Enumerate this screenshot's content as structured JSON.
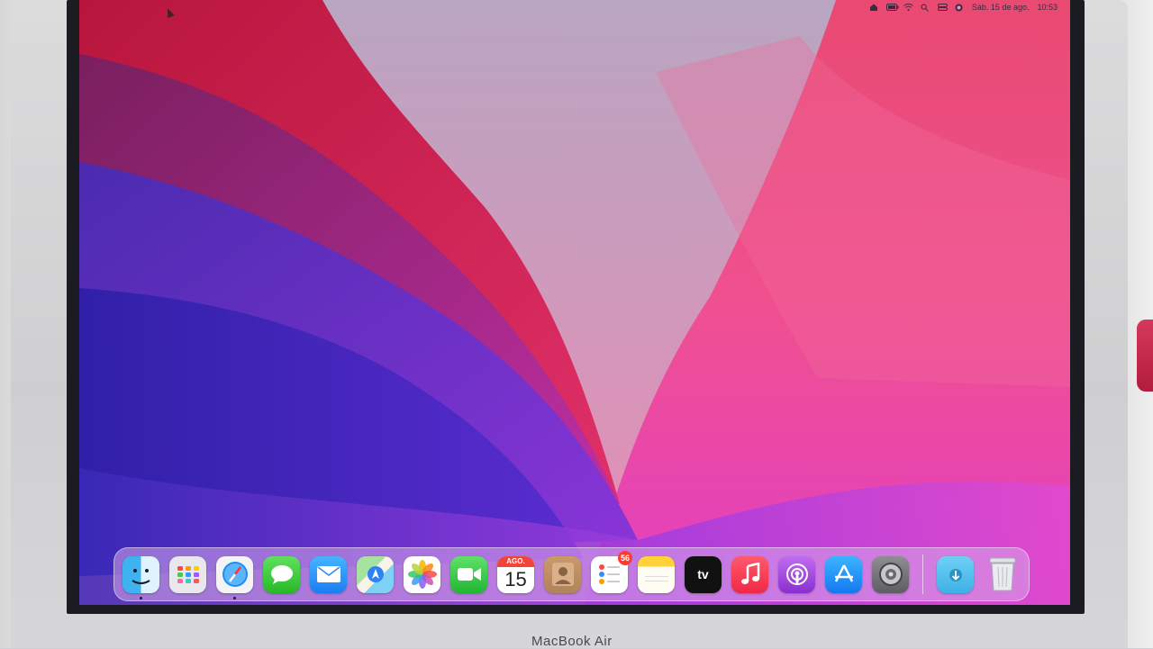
{
  "menubar": {
    "date": "Sáb. 15 de ago.",
    "time": "10:53",
    "icons": [
      "home-icon",
      "battery-icon",
      "wifi-icon",
      "search-icon",
      "control-center-icon",
      "siri-icon"
    ]
  },
  "dock": {
    "apps": [
      {
        "name": "Finder",
        "icon": "finder-icon",
        "running": true
      },
      {
        "name": "Launchpad",
        "icon": "launchpad-icon",
        "running": false
      },
      {
        "name": "Safari",
        "icon": "safari-icon",
        "running": true
      },
      {
        "name": "Messages",
        "icon": "messages-icon",
        "running": false
      },
      {
        "name": "Mail",
        "icon": "mail-icon",
        "running": false
      },
      {
        "name": "Maps",
        "icon": "maps-icon",
        "running": false
      },
      {
        "name": "Photos",
        "icon": "photos-icon",
        "running": false
      },
      {
        "name": "FaceTime",
        "icon": "facetime-icon",
        "running": false
      },
      {
        "name": "Calendar",
        "icon": "calendar-icon",
        "running": false
      },
      {
        "name": "Contacts",
        "icon": "contacts-icon",
        "running": false
      },
      {
        "name": "Reminders",
        "icon": "reminders-icon",
        "running": false
      },
      {
        "name": "Notes",
        "icon": "notes-icon",
        "running": false
      },
      {
        "name": "TV",
        "icon": "apple-tv-icon",
        "running": false
      },
      {
        "name": "Music",
        "icon": "music-icon",
        "running": false
      },
      {
        "name": "Podcasts",
        "icon": "podcasts-icon",
        "running": false
      },
      {
        "name": "App Store",
        "icon": "app-store-icon",
        "running": false
      },
      {
        "name": "System Preferences",
        "icon": "system-preferences-icon",
        "running": false
      },
      {
        "name": "Downloads",
        "icon": "downloads-folder-icon",
        "running": false
      },
      {
        "name": "Trash",
        "icon": "trash-icon",
        "running": false
      }
    ],
    "calendar": {
      "month": "AGO.",
      "day": "15"
    },
    "reminders_badge": "56",
    "tv_label": "tv"
  },
  "hardware": {
    "brand": "MacBook Air"
  },
  "colors": {
    "wallpaper_red": "#d42a4a",
    "wallpaper_pink": "#ff5fa0",
    "wallpaper_purple": "#6a2bd6",
    "wallpaper_blue": "#3a24c0",
    "dock_bg": "#d7aaeb"
  }
}
